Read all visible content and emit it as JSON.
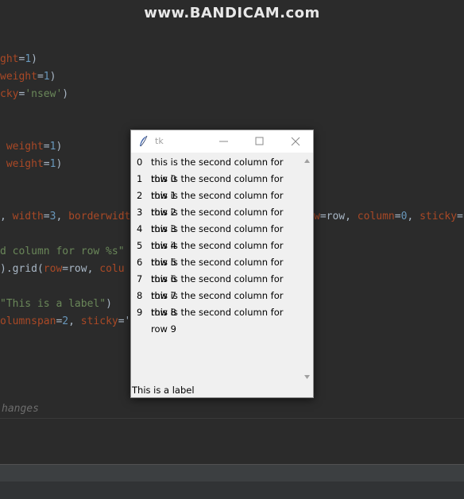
{
  "watermark": "www.BANDICAM.com",
  "editor": {
    "lines": [
      {
        "parts": [
          [
            "par",
            "ght"
          ],
          [
            "",
            "="
          ],
          [
            "num",
            "1"
          ],
          [
            "",
            ")"
          ]
        ]
      },
      {
        "parts": [
          [
            "par",
            "weight"
          ],
          [
            "",
            "="
          ],
          [
            "num",
            "1"
          ],
          [
            "",
            ")"
          ]
        ]
      },
      {
        "parts": [
          [
            "par",
            "cky"
          ],
          [
            "",
            "="
          ],
          [
            "str",
            "'nsew'"
          ],
          [
            "",
            ")"
          ]
        ]
      },
      {
        "parts": [
          [
            "par",
            " weight"
          ],
          [
            "",
            "="
          ],
          [
            "num",
            "1"
          ],
          [
            "",
            ")"
          ]
        ]
      },
      {
        "parts": [
          [
            "par",
            " weight"
          ],
          [
            "",
            "="
          ],
          [
            "num",
            "1"
          ],
          [
            "",
            ")"
          ]
        ]
      },
      {
        "parts": [
          [
            "",
            ", "
          ],
          [
            "par",
            "width"
          ],
          [
            "",
            "="
          ],
          [
            "num",
            "3"
          ],
          [
            "",
            ", "
          ],
          [
            "par",
            "borderwidt"
          ]
        ]
      },
      {
        "parts": [
          [
            "str",
            "d column for row %s\""
          ]
        ]
      },
      {
        "parts": [
          [
            "",
            ")."
          ],
          [
            "",
            "grid("
          ],
          [
            "par",
            "row"
          ],
          [
            "",
            "=row, "
          ],
          [
            "par",
            "colu"
          ]
        ]
      },
      {
        "parts": [
          [
            "str",
            "\"This is a label\""
          ],
          [
            "",
            ")"
          ]
        ]
      },
      {
        "parts": [
          [
            "par",
            "olumnspan"
          ],
          [
            "",
            "="
          ],
          [
            "num",
            "2"
          ],
          [
            "",
            ", "
          ],
          [
            "par",
            "sticky"
          ],
          [
            "",
            "='"
          ]
        ]
      }
    ],
    "right_fragment": [
      [
        "par",
        "w"
      ],
      [
        "",
        "=row, "
      ],
      [
        "par",
        "column"
      ],
      [
        "",
        "="
      ],
      [
        "num",
        "0"
      ],
      [
        "",
        ", "
      ],
      [
        "par",
        "sticky"
      ],
      [
        "",
        "="
      ]
    ],
    "changes_label": "hanges"
  },
  "window": {
    "title": "tk",
    "rows": [
      {
        "index": "0",
        "text": "this is the second column for row 0"
      },
      {
        "index": "1",
        "text": "this is the second column for row 1"
      },
      {
        "index": "2",
        "text": "this is the second column for row 2"
      },
      {
        "index": "3",
        "text": "this is the second column for row 3"
      },
      {
        "index": "4",
        "text": "this is the second column for row 4"
      },
      {
        "index": "5",
        "text": "this is the second column for row 5"
      },
      {
        "index": "6",
        "text": "this is the second column for row 6"
      },
      {
        "index": "7",
        "text": "this is the second column for row 7"
      },
      {
        "index": "8",
        "text": "this is the second column for row 8"
      },
      {
        "index": "9",
        "text": "this is the second column for row 9"
      }
    ],
    "bottom_label": "This is a label"
  }
}
